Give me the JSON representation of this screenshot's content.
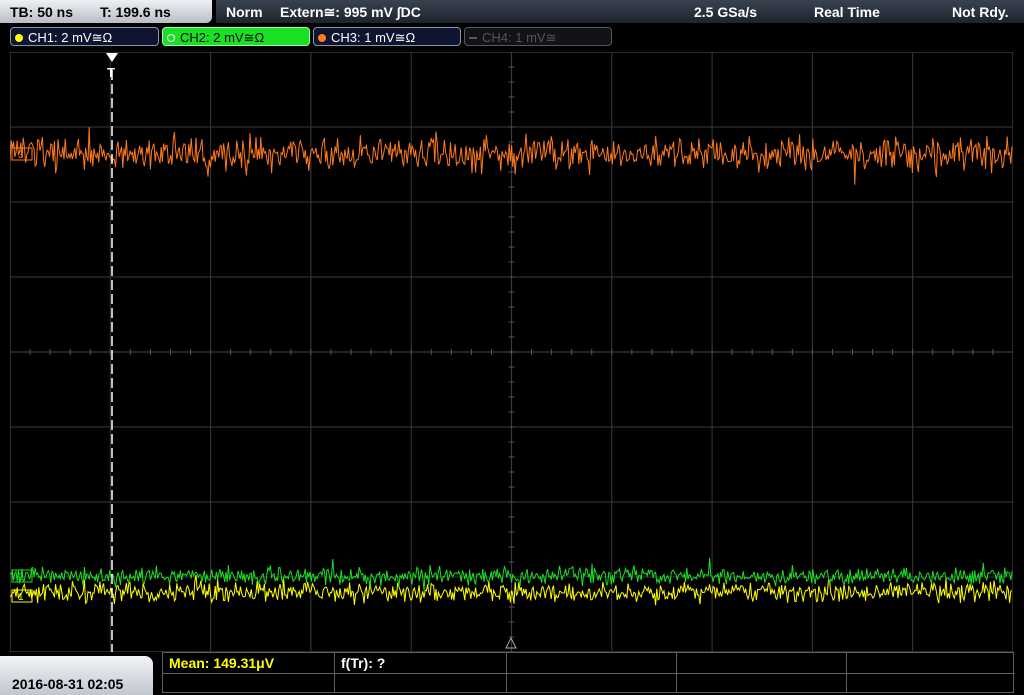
{
  "header": {
    "timebase": "TB: 50 ns",
    "trigger_time": "T: 199.6 ns",
    "trigger_mode": "Norm",
    "trigger_source": "Extern≅: 995 mV ∫DC",
    "sample_rate": "2.5 GSa/s",
    "acq_mode": "Real Time",
    "status": "Not Rdy."
  },
  "channels": [
    {
      "label": "CH1: 2 mV≅Ω",
      "color": "#ffff00",
      "state": "on"
    },
    {
      "label": "CH2: 2 mV≅Ω",
      "color": "#19e025",
      "state": "selected"
    },
    {
      "label": "CH3: 1 mV≅Ω",
      "color": "#ff7a1a",
      "state": "on"
    },
    {
      "label": "CH4: 1 mV≅",
      "color": "#555555",
      "state": "off"
    }
  ],
  "screen": {
    "trigger_marker": "T",
    "ch1_marker": "1",
    "ch2_marker": "2",
    "ch3_marker": "3"
  },
  "footer": {
    "datetime": "2016-08-31 02:05",
    "measurement_1": "Mean: 149.31μV",
    "measurement_2": "f(Tr): ?"
  },
  "colors": {
    "ch1": "#ffff00",
    "ch2": "#19e025",
    "ch3": "#ff7a1a",
    "grid": "#3a3a3a",
    "status_bg": "#2a303c"
  }
}
